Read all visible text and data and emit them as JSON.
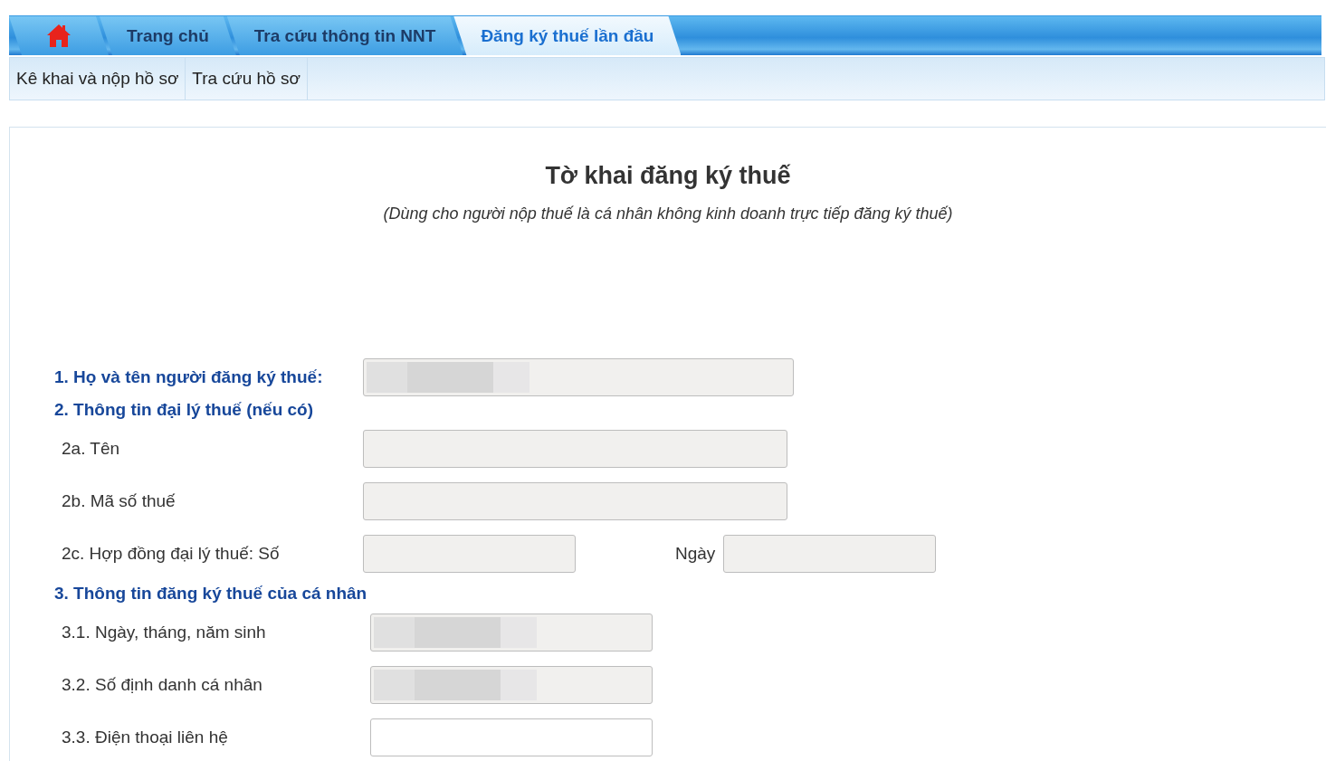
{
  "nav_tabs": [
    {
      "kind": "home",
      "selected": false
    },
    {
      "kind": "text",
      "label": "Trang chủ",
      "selected": false
    },
    {
      "kind": "text",
      "label": "Tra cứu thông tin NNT",
      "selected": false
    },
    {
      "kind": "text",
      "label": "Đăng ký thuế lần đầu",
      "selected": true
    }
  ],
  "sub_nav": [
    "Kê khai và nộp hồ sơ",
    "Tra cứu hồ sơ"
  ],
  "form": {
    "title": "Tờ khai đăng ký thuế",
    "subtitle": "(Dùng cho người nộp thuế là cá nhân không kinh doanh trực tiếp đăng ký thuế)",
    "sections": [
      {
        "kind": "name",
        "heading": "1. Họ và tên người đăng ký thuế:",
        "field": {
          "disabled": true,
          "redacted": true
        }
      },
      {
        "kind": "agent",
        "heading": "2. Thông tin đại lý thuế (nếu có)",
        "rows": [
          {
            "label": "2a. Tên",
            "field": {
              "disabled": true,
              "redacted": false
            }
          },
          {
            "label": "2b. Mã số thuế",
            "field": {
              "disabled": true,
              "redacted": false
            }
          },
          {
            "label": "2c. Hợp đồng đại lý thuế: Số",
            "field": {
              "disabled": true,
              "redacted": false
            },
            "label_2": "Ngày",
            "field_2": {
              "disabled": true,
              "redacted": false
            }
          }
        ]
      },
      {
        "kind": "personal",
        "heading": "3. Thông tin đăng ký thuế của cá nhân",
        "rows": [
          {
            "label": "3.1. Ngày, tháng, năm sinh",
            "field": {
              "disabled": true,
              "redacted": true
            }
          },
          {
            "label": "3.2. Số định danh cá nhân",
            "field": {
              "disabled": true,
              "redacted": true
            }
          },
          {
            "label": "3.3. Điện thoại liên hệ",
            "field": {
              "disabled": false,
              "redacted": false
            }
          }
        ]
      }
    ]
  }
}
